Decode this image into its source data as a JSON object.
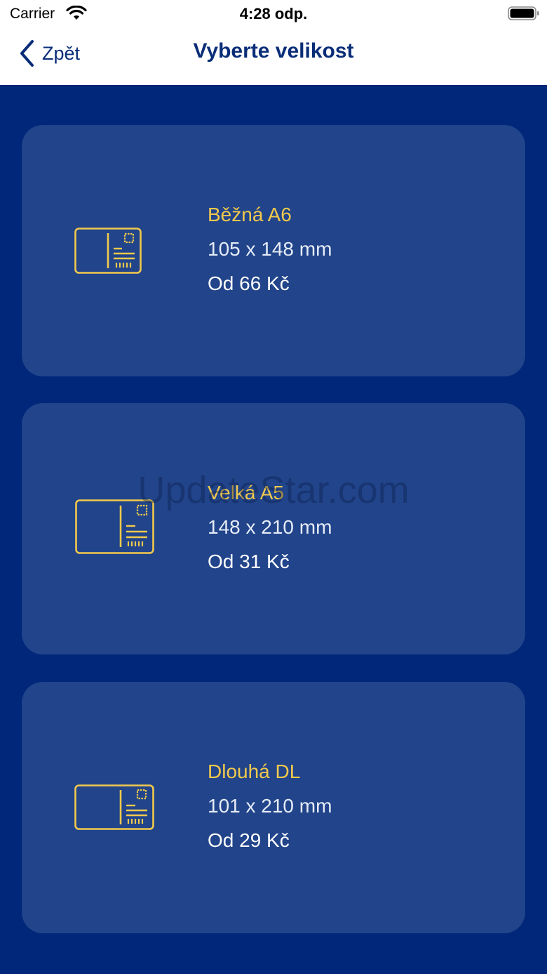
{
  "status_bar": {
    "carrier": "Carrier",
    "time": "4:28 odp."
  },
  "nav": {
    "back_label": "Zpět",
    "title": "Vyberte velikost"
  },
  "cards": [
    {
      "name": "Běžná A6",
      "dimensions": "105 x 148 mm",
      "price": "Od 66 Kč",
      "icon": "postcard-icon"
    },
    {
      "name": "Velká A5",
      "dimensions": "148 x 210 mm",
      "price": "Od 31 Kč",
      "icon": "postcard-icon"
    },
    {
      "name": "Dlouhá DL",
      "dimensions": "101 x 210 mm",
      "price": "Od 29 Kč",
      "icon": "postcard-icon"
    }
  ],
  "watermark": "UpdateStar.com",
  "colors": {
    "background": "#00277A",
    "card": "#21448A",
    "accent": "#F2C94C",
    "nav_text": "#0A2D78"
  }
}
